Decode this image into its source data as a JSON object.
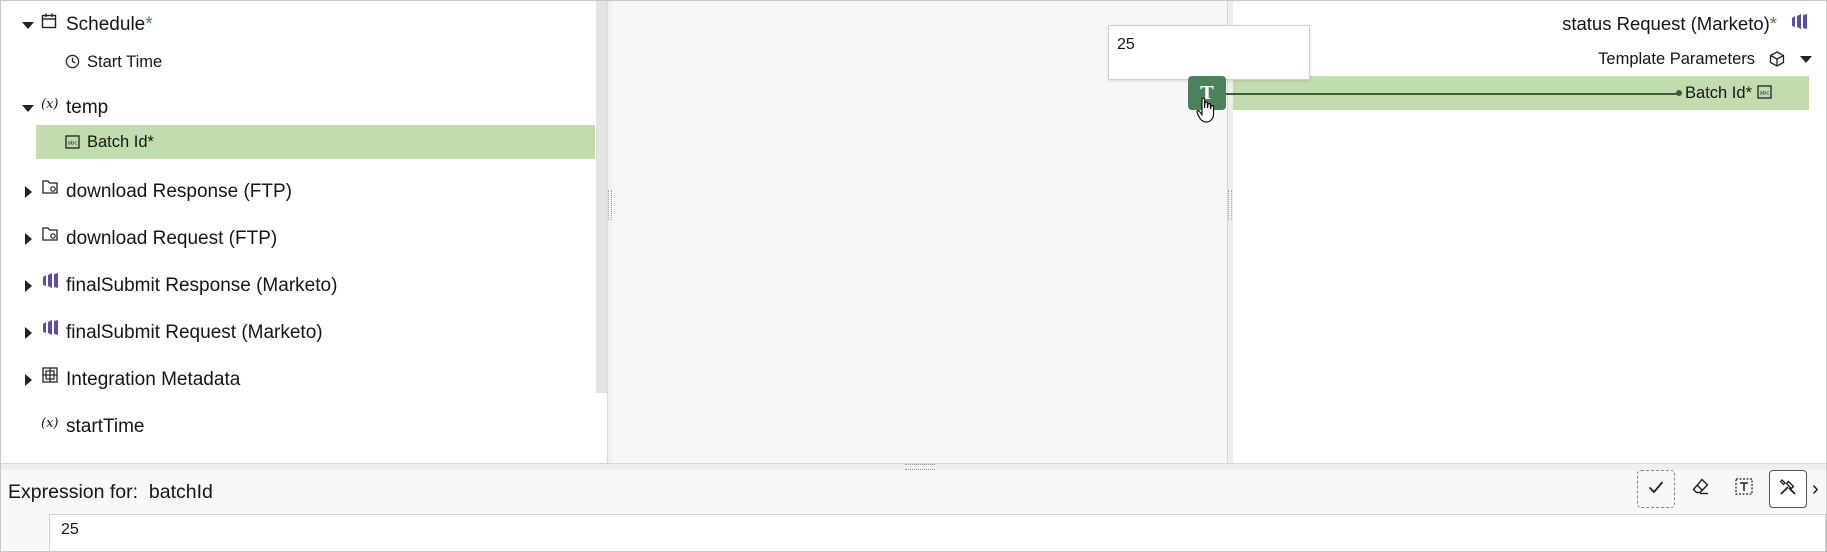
{
  "source_tree": {
    "items": [
      {
        "label": "Schedule",
        "required_mark": "*",
        "icon": "calendar-icon",
        "expanded": true
      },
      {
        "label": "Start Time",
        "icon": "clock-icon"
      },
      {
        "label": "temp",
        "icon": "variable-icon",
        "expanded": true
      },
      {
        "label": "Batch Id",
        "required_mark": "*",
        "icon": "string-field-icon",
        "selected": true
      },
      {
        "label": "download Response (FTP)",
        "icon": "ftp-folder-icon"
      },
      {
        "label": "download Request (FTP)",
        "icon": "ftp-folder-icon"
      },
      {
        "label": "finalSubmit Response (Marketo)",
        "icon": "marketo-icon"
      },
      {
        "label": "finalSubmit Request (Marketo)",
        "icon": "marketo-icon"
      },
      {
        "label": "Integration Metadata",
        "icon": "metadata-icon"
      },
      {
        "label": "startTime",
        "icon": "variable-icon"
      }
    ],
    "variable_glyph": "(x)"
  },
  "canvas": {
    "tooltip_value": "25",
    "node_glyph": "T"
  },
  "target_tree": {
    "title": "status Request (Marketo)",
    "title_mark": "*",
    "template_label": "Template Parameters",
    "mapped_field": "Batch Id",
    "mapped_mark": "*"
  },
  "expression": {
    "label": "Expression for:",
    "target": "batchId",
    "value": "25"
  },
  "toolbar": {
    "buttons": [
      "check-icon",
      "eraser-icon",
      "text-literal-icon",
      "tools-icon"
    ],
    "collapse_glyph": "›"
  },
  "colors": {
    "selection": "#c1ddb0",
    "node": "#4c825a",
    "required": "#3d8b3d",
    "marketo": "#5c4ea8"
  }
}
